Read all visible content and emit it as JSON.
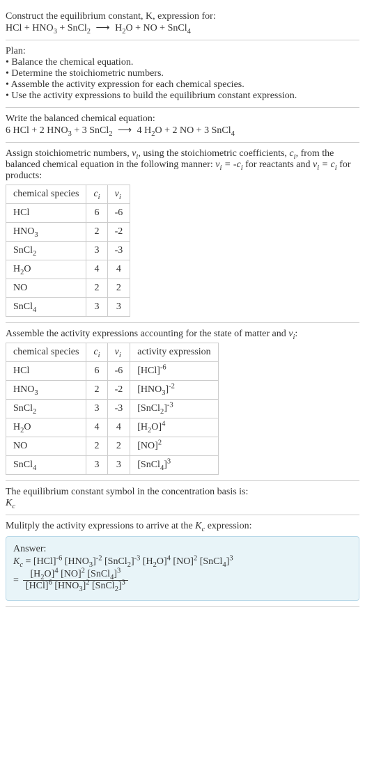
{
  "intro": {
    "line1": "Construct the equilibrium constant, K, expression for:",
    "eq_lhs": "HCl + HNO₃ + SnCl₂",
    "eq_rhs": "H₂O + NO + SnCl₄"
  },
  "plan": {
    "title": "Plan:",
    "items": [
      "Balance the chemical equation.",
      "Determine the stoichiometric numbers.",
      "Assemble the activity expression for each chemical species.",
      "Use the activity expressions to build the equilibrium constant expression."
    ]
  },
  "balanced": {
    "title": "Write the balanced chemical equation:",
    "lhs": "6 HCl + 2 HNO₃ + 3 SnCl₂",
    "rhs": "4 H₂O + 2 NO + 3 SnCl₄"
  },
  "stoich": {
    "text_a": "Assign stoichiometric numbers, ",
    "text_b": ", using the stoichiometric coefficients, ",
    "text_c": ", from the balanced chemical equation in the following manner: ",
    "text_d": " for reactants and ",
    "text_e": " for products:",
    "headers": [
      "chemical species",
      "cᵢ",
      "νᵢ"
    ],
    "rows": [
      {
        "sp": "HCl",
        "c": "6",
        "v": "-6"
      },
      {
        "sp": "HNO₃",
        "c": "2",
        "v": "-2"
      },
      {
        "sp": "SnCl₂",
        "c": "3",
        "v": "-3"
      },
      {
        "sp": "H₂O",
        "c": "4",
        "v": "4"
      },
      {
        "sp": "NO",
        "c": "2",
        "v": "2"
      },
      {
        "sp": "SnCl₄",
        "c": "3",
        "v": "3"
      }
    ]
  },
  "activity": {
    "title": "Assemble the activity expressions accounting for the state of matter and νᵢ:",
    "headers": [
      "chemical species",
      "cᵢ",
      "νᵢ",
      "activity expression"
    ],
    "rows": [
      {
        "sp": "HCl",
        "c": "6",
        "v": "-6",
        "base": "HCl",
        "exp": "-6"
      },
      {
        "sp": "HNO₃",
        "c": "2",
        "v": "-2",
        "base": "HNO₃",
        "exp": "-2"
      },
      {
        "sp": "SnCl₂",
        "c": "3",
        "v": "-3",
        "base": "SnCl₂",
        "exp": "-3"
      },
      {
        "sp": "H₂O",
        "c": "4",
        "v": "4",
        "base": "H₂O",
        "exp": "4"
      },
      {
        "sp": "NO",
        "c": "2",
        "v": "2",
        "base": "NO",
        "exp": "2"
      },
      {
        "sp": "SnCl₄",
        "c": "3",
        "v": "3",
        "base": "SnCl₄",
        "exp": "3"
      }
    ]
  },
  "symbol": {
    "line1": "The equilibrium constant symbol in the concentration basis is:",
    "sym": "K_c"
  },
  "final": {
    "title": "Mulitply the activity expressions to arrive at the K_c expression:",
    "answer_label": "Answer:"
  }
}
